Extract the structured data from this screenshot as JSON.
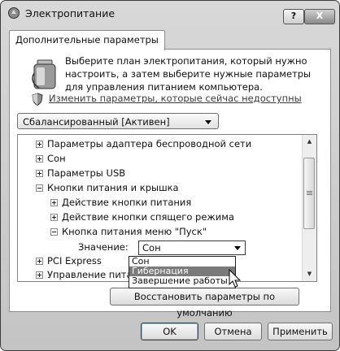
{
  "window": {
    "title": "Электропитание",
    "help_label": "?",
    "close_label": "X"
  },
  "tab": {
    "label": "Дополнительные параметры"
  },
  "intro": {
    "text": "Выберите план электропитания, который нужно настроить, а затем выберите нужные параметры для управления питанием компьютера.",
    "link": "Изменить параметры, которые сейчас недоступны"
  },
  "plan": {
    "selected": "Сбалансированный [Активен]"
  },
  "tree": {
    "items": [
      {
        "label": "Параметры адаптера беспроводной сети",
        "expander": "plus"
      },
      {
        "label": "Сон",
        "expander": "plus"
      },
      {
        "label": "Параметры USB",
        "expander": "plus"
      },
      {
        "label": "Кнопки питания и крышка",
        "expander": "minus"
      },
      {
        "label": "Действие кнопки питания",
        "expander": "plus"
      },
      {
        "label": "Действие кнопки спящего режима",
        "expander": "plus"
      },
      {
        "label": "Кнопка питания меню \"Пуск\"",
        "expander": "minus"
      },
      {
        "label": "PCI Express",
        "expander": "plus"
      },
      {
        "label": "Управление питани",
        "expander": "plus"
      }
    ],
    "value_label": "Значение:",
    "value_selected": "Сон"
  },
  "dropdown": {
    "options": [
      "Сон",
      "Гибернация",
      "Завершение работы"
    ],
    "highlighted": "Гибернация"
  },
  "buttons": {
    "restore": "Восстановить параметры по умолчанию",
    "ok": "OK",
    "cancel": "Отмена",
    "apply": "Применить"
  }
}
